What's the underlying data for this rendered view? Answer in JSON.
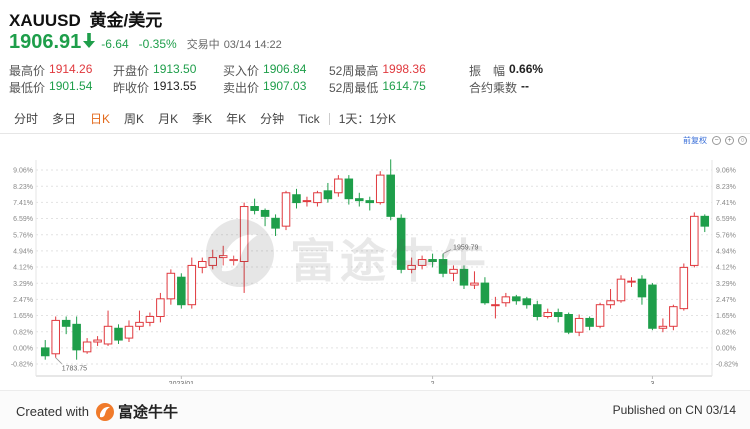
{
  "header": {
    "symbol": "XAUUSD",
    "name": "黄金/美元",
    "last_price": "1906.91",
    "change": "-6.64",
    "change_pct": "-0.35%",
    "status": "交易中",
    "time": "03/14 14:22"
  },
  "stats": {
    "row1": [
      {
        "label": "最高价",
        "value": "1914.26",
        "color": "#e0393e"
      },
      {
        "label": "开盘价",
        "value": "1913.50",
        "color": "#1e9e4a"
      },
      {
        "label": "买入价",
        "value": "1906.84",
        "color": "#1e9e4a"
      },
      {
        "label": "52周最高",
        "value": "1998.36",
        "color": "#e0393e"
      },
      {
        "label": "振　幅",
        "value": "0.66%",
        "color": "#222222"
      }
    ],
    "row2": [
      {
        "label": "最低价",
        "value": "1901.54",
        "color": "#1e9e4a"
      },
      {
        "label": "昨收价",
        "value": "1913.55",
        "color": "#222222"
      },
      {
        "label": "卖出价",
        "value": "1907.03",
        "color": "#1e9e4a"
      },
      {
        "label": "52周最低",
        "value": "1614.75",
        "color": "#1e9e4a"
      },
      {
        "label": "合约乘数",
        "value": "--",
        "color": "#222222"
      }
    ]
  },
  "tabs": [
    "分时",
    "多日",
    "日K",
    "周K",
    "月K",
    "季K",
    "年K",
    "分钟",
    "Tick",
    "1天：1分K"
  ],
  "active_tab": "日K",
  "chart_controls": {
    "adjust_link": "前复权",
    "zoom_out": "−",
    "zoom_in": "+",
    "reset": "○"
  },
  "watermark": {
    "text": "富途牛牛"
  },
  "footer": {
    "created_with": "Created with",
    "brand": "富途牛牛",
    "published": "Published on CN 03/14"
  },
  "colors": {
    "up": "#e0393e",
    "down": "#1e9e4a",
    "accent": "#e36a1c"
  },
  "chart_data": {
    "type": "candlestick",
    "y_ticks": [
      "9.06%",
      "8.23%",
      "7.41%",
      "6.59%",
      "5.76%",
      "4.94%",
      "4.12%",
      "3.29%",
      "2.47%",
      "1.65%",
      "0.82%",
      "0.00%",
      "-0.82%"
    ],
    "ylim": [
      -0.82,
      9.06
    ],
    "x_ticks": [
      {
        "label": "2023/01",
        "index": 13
      },
      {
        "label": "2",
        "index": 37
      },
      {
        "label": "3",
        "index": 58
      }
    ],
    "annotations": [
      {
        "label": "1959.79",
        "value": "high",
        "index": 38
      },
      {
        "label": "1783.75",
        "value": "low",
        "index": 1
      }
    ],
    "candles": [
      {
        "o": 0.0,
        "c": -0.4,
        "h": 0.4,
        "l": -0.6
      },
      {
        "o": -0.3,
        "c": 1.4,
        "h": 1.6,
        "l": -0.5
      },
      {
        "o": 1.4,
        "c": 1.1,
        "h": 1.6,
        "l": 0.7
      },
      {
        "o": 1.2,
        "c": -0.1,
        "h": 1.6,
        "l": -0.6
      },
      {
        "o": -0.2,
        "c": 0.3,
        "h": 0.5,
        "l": -0.3
      },
      {
        "o": 0.3,
        "c": 0.4,
        "h": 0.6,
        "l": 0.1
      },
      {
        "o": 0.2,
        "c": 1.1,
        "h": 1.9,
        "l": 0.1
      },
      {
        "o": 1.0,
        "c": 0.4,
        "h": 1.2,
        "l": 0.2
      },
      {
        "o": 0.5,
        "c": 1.1,
        "h": 1.4,
        "l": 0.3
      },
      {
        "o": 1.1,
        "c": 1.3,
        "h": 1.9,
        "l": 0.9
      },
      {
        "o": 1.3,
        "c": 1.6,
        "h": 1.8,
        "l": 1.1
      },
      {
        "o": 1.6,
        "c": 2.5,
        "h": 2.8,
        "l": 1.3
      },
      {
        "o": 2.5,
        "c": 3.8,
        "h": 4.0,
        "l": 2.2
      },
      {
        "o": 3.6,
        "c": 2.2,
        "h": 3.8,
        "l": 2.0
      },
      {
        "o": 2.2,
        "c": 4.2,
        "h": 4.6,
        "l": 2.0
      },
      {
        "o": 4.1,
        "c": 4.4,
        "h": 4.6,
        "l": 3.8
      },
      {
        "o": 4.2,
        "c": 4.6,
        "h": 5.0,
        "l": 4.0
      },
      {
        "o": 4.6,
        "c": 4.7,
        "h": 5.2,
        "l": 4.2
      },
      {
        "o": 4.5,
        "c": 4.5,
        "h": 4.7,
        "l": 4.2
      },
      {
        "o": 4.4,
        "c": 7.2,
        "h": 7.4,
        "l": 2.8
      },
      {
        "o": 7.2,
        "c": 7.0,
        "h": 7.6,
        "l": 6.8
      },
      {
        "o": 7.0,
        "c": 6.7,
        "h": 7.1,
        "l": 6.2
      },
      {
        "o": 6.6,
        "c": 6.1,
        "h": 6.8,
        "l": 5.7
      },
      {
        "o": 6.2,
        "c": 7.9,
        "h": 8.0,
        "l": 6.0
      },
      {
        "o": 7.8,
        "c": 7.4,
        "h": 8.1,
        "l": 7.1
      },
      {
        "o": 7.5,
        "c": 7.5,
        "h": 7.7,
        "l": 7.2
      },
      {
        "o": 7.4,
        "c": 7.9,
        "h": 8.0,
        "l": 7.2
      },
      {
        "o": 8.0,
        "c": 7.6,
        "h": 8.4,
        "l": 7.4
      },
      {
        "o": 7.9,
        "c": 8.6,
        "h": 8.8,
        "l": 7.7
      },
      {
        "o": 8.6,
        "c": 7.6,
        "h": 8.8,
        "l": 7.3
      },
      {
        "o": 7.6,
        "c": 7.5,
        "h": 7.9,
        "l": 7.2
      },
      {
        "o": 7.5,
        "c": 7.4,
        "h": 7.7,
        "l": 7.0
      },
      {
        "o": 7.4,
        "c": 8.8,
        "h": 9.0,
        "l": 7.3
      },
      {
        "o": 8.8,
        "c": 6.7,
        "h": 9.6,
        "l": 6.5
      },
      {
        "o": 6.6,
        "c": 4.0,
        "h": 6.8,
        "l": 3.8
      },
      {
        "o": 4.0,
        "c": 4.2,
        "h": 4.6,
        "l": 3.8
      },
      {
        "o": 4.2,
        "c": 4.5,
        "h": 4.7,
        "l": 4.0
      },
      {
        "o": 4.5,
        "c": 4.4,
        "h": 4.8,
        "l": 4.1
      },
      {
        "o": 4.5,
        "c": 3.8,
        "h": 4.8,
        "l": 3.6
      },
      {
        "o": 3.8,
        "c": 4.0,
        "h": 4.2,
        "l": 3.4
      },
      {
        "o": 4.0,
        "c": 3.2,
        "h": 4.2,
        "l": 3.0
      },
      {
        "o": 3.2,
        "c": 3.3,
        "h": 3.9,
        "l": 3.0
      },
      {
        "o": 3.3,
        "c": 2.3,
        "h": 3.6,
        "l": 2.2
      },
      {
        "o": 2.2,
        "c": 2.2,
        "h": 2.6,
        "l": 1.5
      },
      {
        "o": 2.3,
        "c": 2.6,
        "h": 2.8,
        "l": 2.1
      },
      {
        "o": 2.6,
        "c": 2.4,
        "h": 2.7,
        "l": 2.2
      },
      {
        "o": 2.5,
        "c": 2.2,
        "h": 2.6,
        "l": 2.0
      },
      {
        "o": 2.2,
        "c": 1.6,
        "h": 2.4,
        "l": 1.4
      },
      {
        "o": 1.6,
        "c": 1.8,
        "h": 2.0,
        "l": 1.5
      },
      {
        "o": 1.8,
        "c": 1.6,
        "h": 2.0,
        "l": 1.3
      },
      {
        "o": 1.7,
        "c": 0.8,
        "h": 1.8,
        "l": 0.7
      },
      {
        "o": 0.8,
        "c": 1.5,
        "h": 1.7,
        "l": 0.6
      },
      {
        "o": 1.5,
        "c": 1.1,
        "h": 1.6,
        "l": 0.9
      },
      {
        "o": 1.1,
        "c": 2.2,
        "h": 2.3,
        "l": 1.0
      },
      {
        "o": 2.2,
        "c": 2.4,
        "h": 3.0,
        "l": 2.0
      },
      {
        "o": 2.4,
        "c": 3.5,
        "h": 3.7,
        "l": 2.3
      },
      {
        "o": 3.4,
        "c": 3.4,
        "h": 3.6,
        "l": 3.1
      },
      {
        "o": 3.5,
        "c": 2.6,
        "h": 3.7,
        "l": 2.2
      },
      {
        "o": 3.2,
        "c": 1.0,
        "h": 3.3,
        "l": 0.9
      },
      {
        "o": 1.0,
        "c": 1.1,
        "h": 1.5,
        "l": 0.8
      },
      {
        "o": 1.1,
        "c": 2.1,
        "h": 2.2,
        "l": 0.9
      },
      {
        "o": 2.0,
        "c": 4.1,
        "h": 4.3,
        "l": 1.9
      },
      {
        "o": 4.2,
        "c": 6.7,
        "h": 6.9,
        "l": 4.1
      },
      {
        "o": 6.7,
        "c": 6.2,
        "h": 6.8,
        "l": 5.9
      }
    ]
  }
}
